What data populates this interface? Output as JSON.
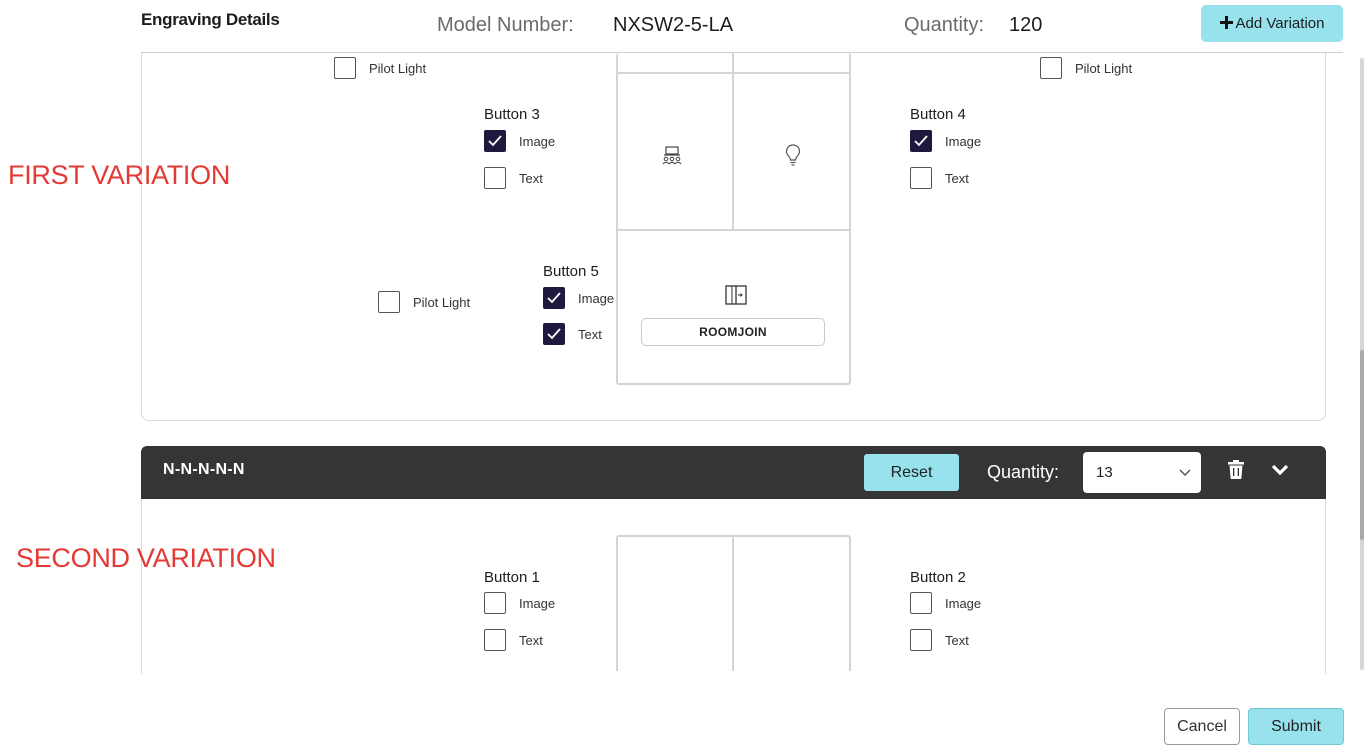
{
  "header": {
    "title": "Engraving Details",
    "model_label": "Model Number:",
    "model_value": "NXSW2-5-LA",
    "quantity_label": "Quantity:",
    "quantity_value": "120",
    "add_variation": "Add Variation"
  },
  "annotations": {
    "first": "FIRST VARIATION",
    "second": "SECOND VARIATION"
  },
  "variation1": {
    "pilot_light_left": "Pilot Light",
    "pilot_light_right": "Pilot Light",
    "pilot_light_b5": "Pilot Light",
    "button3": {
      "title": "Button 3",
      "image": "Image",
      "text": "Text",
      "image_checked": true,
      "text_checked": false
    },
    "button4": {
      "title": "Button 4",
      "image": "Image",
      "text": "Text",
      "image_checked": true,
      "text_checked": false
    },
    "button5": {
      "title": "Button 5",
      "image": "Image",
      "text": "Text",
      "image_checked": true,
      "text_checked": true
    },
    "cells": {
      "b3_icon": "audience-icon",
      "b4_icon": "lightbulb-icon",
      "b5_icon": "room-join-icon",
      "b5_text": "ROOMJOIN"
    }
  },
  "variation2": {
    "name": "N-N-N-N-N",
    "reset": "Reset",
    "quantity_label": "Quantity:",
    "quantity_value": "13",
    "button1": {
      "title": "Button 1",
      "image": "Image",
      "text": "Text",
      "image_checked": false,
      "text_checked": false
    },
    "button2": {
      "title": "Button 2",
      "image": "Image",
      "text": "Text",
      "image_checked": false,
      "text_checked": false
    }
  },
  "footer": {
    "cancel": "Cancel",
    "submit": "Submit"
  },
  "colors": {
    "accent": "#97e2ec",
    "checkbox_checked": "#1e1a3f",
    "annotation": "#e43a35",
    "variation_bar": "#353535"
  }
}
